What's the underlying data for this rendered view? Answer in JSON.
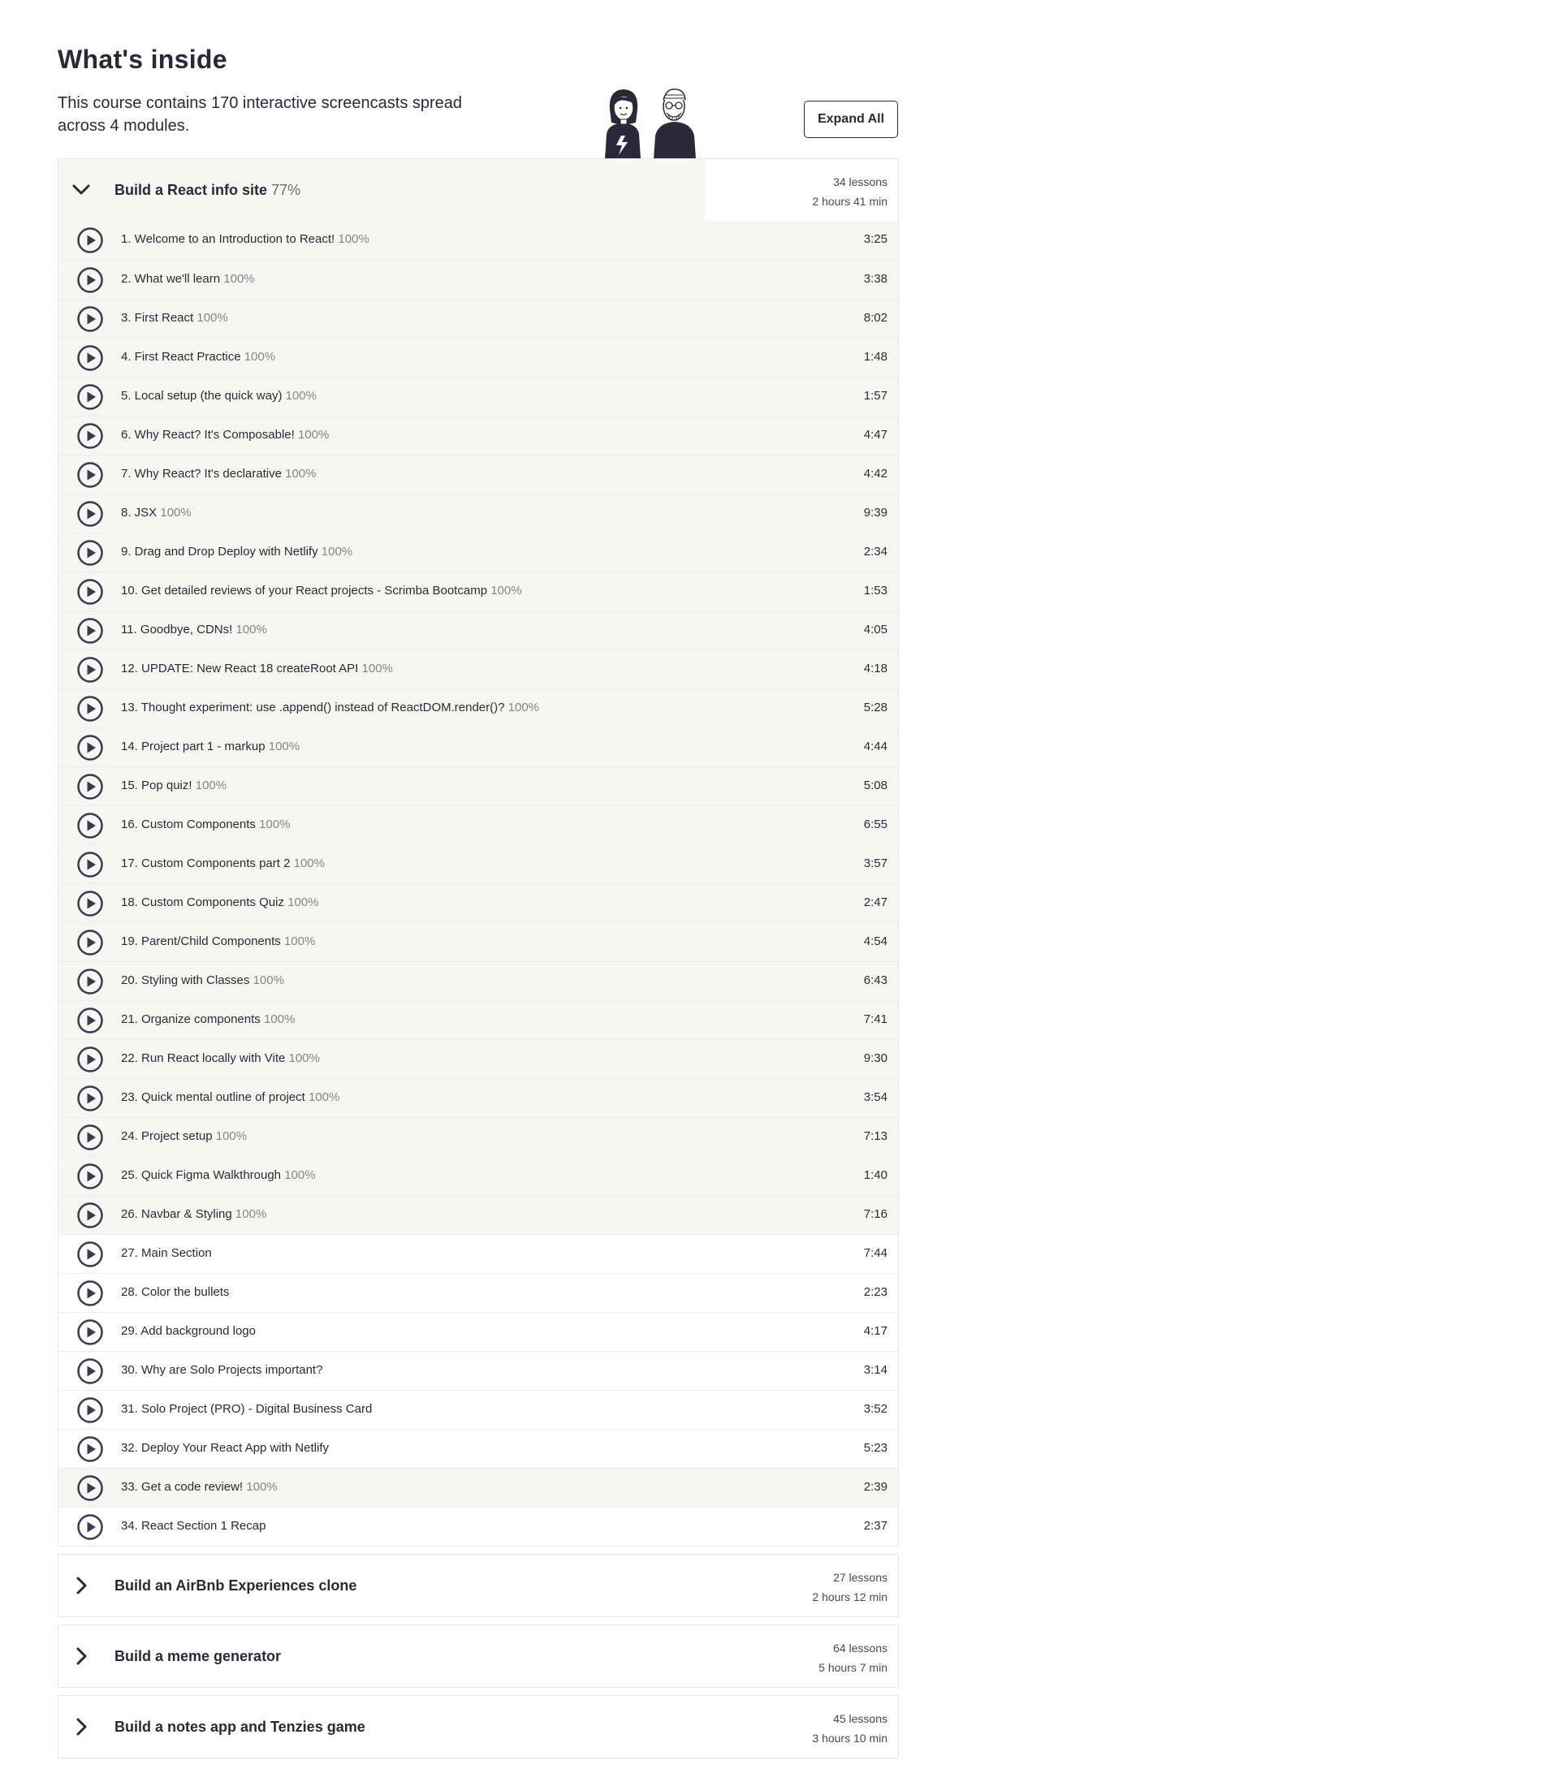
{
  "page": {
    "heading": "What's inside",
    "intro": "This course contains 170 interactive screencasts spread across 4 modules.",
    "expand_label": "Expand All",
    "illustration_icon": "two-instructors-illustration"
  },
  "colors": {
    "completed_bg": "#f3f9f1",
    "text": "#2b283a",
    "muted": "#84838e",
    "play_icon": "#3b3955"
  },
  "modules": [
    {
      "title": "Build a React info site",
      "progress_label": "77%",
      "progress": 0.77,
      "lessons_label": "34 lessons",
      "duration_label": "2 hours 41 min",
      "expanded": true,
      "icon": "chevron-down-icon"
    },
    {
      "title": "Build an AirBnb Experiences clone",
      "progress_label": "",
      "progress": 0,
      "lessons_label": "27 lessons",
      "duration_label": "2 hours 12 min",
      "expanded": false,
      "icon": "chevron-right-icon"
    },
    {
      "title": "Build a meme generator",
      "progress_label": "",
      "progress": 0,
      "lessons_label": "64 lessons",
      "duration_label": "5 hours 7 min",
      "expanded": false,
      "icon": "chevron-right-icon"
    },
    {
      "title": "Build a notes app and Tenzies game",
      "progress_label": "",
      "progress": 0,
      "lessons_label": "45 lessons",
      "duration_label": "3 hours 10 min",
      "expanded": false,
      "icon": "chevron-right-icon"
    }
  ],
  "lessons": [
    {
      "title": "1. Welcome to an Introduction to React!",
      "pct": "100%",
      "time": "3:25"
    },
    {
      "title": "2. What we'll learn",
      "pct": "100%",
      "time": "3:38"
    },
    {
      "title": "3. First React",
      "pct": "100%",
      "time": "8:02"
    },
    {
      "title": "4. First React Practice",
      "pct": "100%",
      "time": "1:48"
    },
    {
      "title": "5. Local setup (the quick way)",
      "pct": "100%",
      "time": "1:57"
    },
    {
      "title": "6. Why React? It's Composable!",
      "pct": "100%",
      "time": "4:47"
    },
    {
      "title": "7. Why React? It's declarative",
      "pct": "100%",
      "time": "4:42"
    },
    {
      "title": "8. JSX",
      "pct": "100%",
      "time": "9:39"
    },
    {
      "title": "9. Drag and Drop Deploy with Netlify",
      "pct": "100%",
      "time": "2:34"
    },
    {
      "title": "10. Get detailed reviews of your React projects - Scrimba Bootcamp",
      "pct": "100%",
      "time": "1:53"
    },
    {
      "title": "11. Goodbye, CDNs!",
      "pct": "100%",
      "time": "4:05"
    },
    {
      "title": "12. UPDATE: New React 18 createRoot API",
      "pct": "100%",
      "time": "4:18"
    },
    {
      "title": "13. Thought experiment: use .append() instead of ReactDOM.render()?",
      "pct": "100%",
      "time": "5:28"
    },
    {
      "title": "14. Project part 1 - markup",
      "pct": "100%",
      "time": "4:44"
    },
    {
      "title": "15. Pop quiz!",
      "pct": "100%",
      "time": "5:08"
    },
    {
      "title": "16. Custom Components",
      "pct": "100%",
      "time": "6:55"
    },
    {
      "title": "17. Custom Components part 2",
      "pct": "100%",
      "time": "3:57"
    },
    {
      "title": "18. Custom Components Quiz",
      "pct": "100%",
      "time": "2:47"
    },
    {
      "title": "19. Parent/Child Components",
      "pct": "100%",
      "time": "4:54"
    },
    {
      "title": "20. Styling with Classes",
      "pct": "100%",
      "time": "6:43"
    },
    {
      "title": "21. Organize components",
      "pct": "100%",
      "time": "7:41"
    },
    {
      "title": "22. Run React locally with Vite",
      "pct": "100%",
      "time": "9:30"
    },
    {
      "title": "23. Quick mental outline of project",
      "pct": "100%",
      "time": "3:54"
    },
    {
      "title": "24. Project setup",
      "pct": "100%",
      "time": "7:13"
    },
    {
      "title": "25. Quick Figma Walkthrough",
      "pct": "100%",
      "time": "1:40"
    },
    {
      "title": "26. Navbar & Styling",
      "pct": "100%",
      "time": "7:16"
    },
    {
      "title": "27. Main Section",
      "pct": "",
      "time": "7:44"
    },
    {
      "title": "28. Color the bullets",
      "pct": "",
      "time": "2:23"
    },
    {
      "title": "29. Add background logo",
      "pct": "",
      "time": "4:17"
    },
    {
      "title": "30. Why are Solo Projects important?",
      "pct": "",
      "time": "3:14"
    },
    {
      "title": "31. Solo Project (PRO) - Digital Business Card",
      "pct": "",
      "time": "3:52"
    },
    {
      "title": "32. Deploy Your React App with Netlify",
      "pct": "",
      "time": "5:23"
    },
    {
      "title": "33. Get a code review!",
      "pct": "100%",
      "time": "2:39"
    },
    {
      "title": "34. React Section 1 Recap",
      "pct": "",
      "time": "2:37"
    }
  ]
}
